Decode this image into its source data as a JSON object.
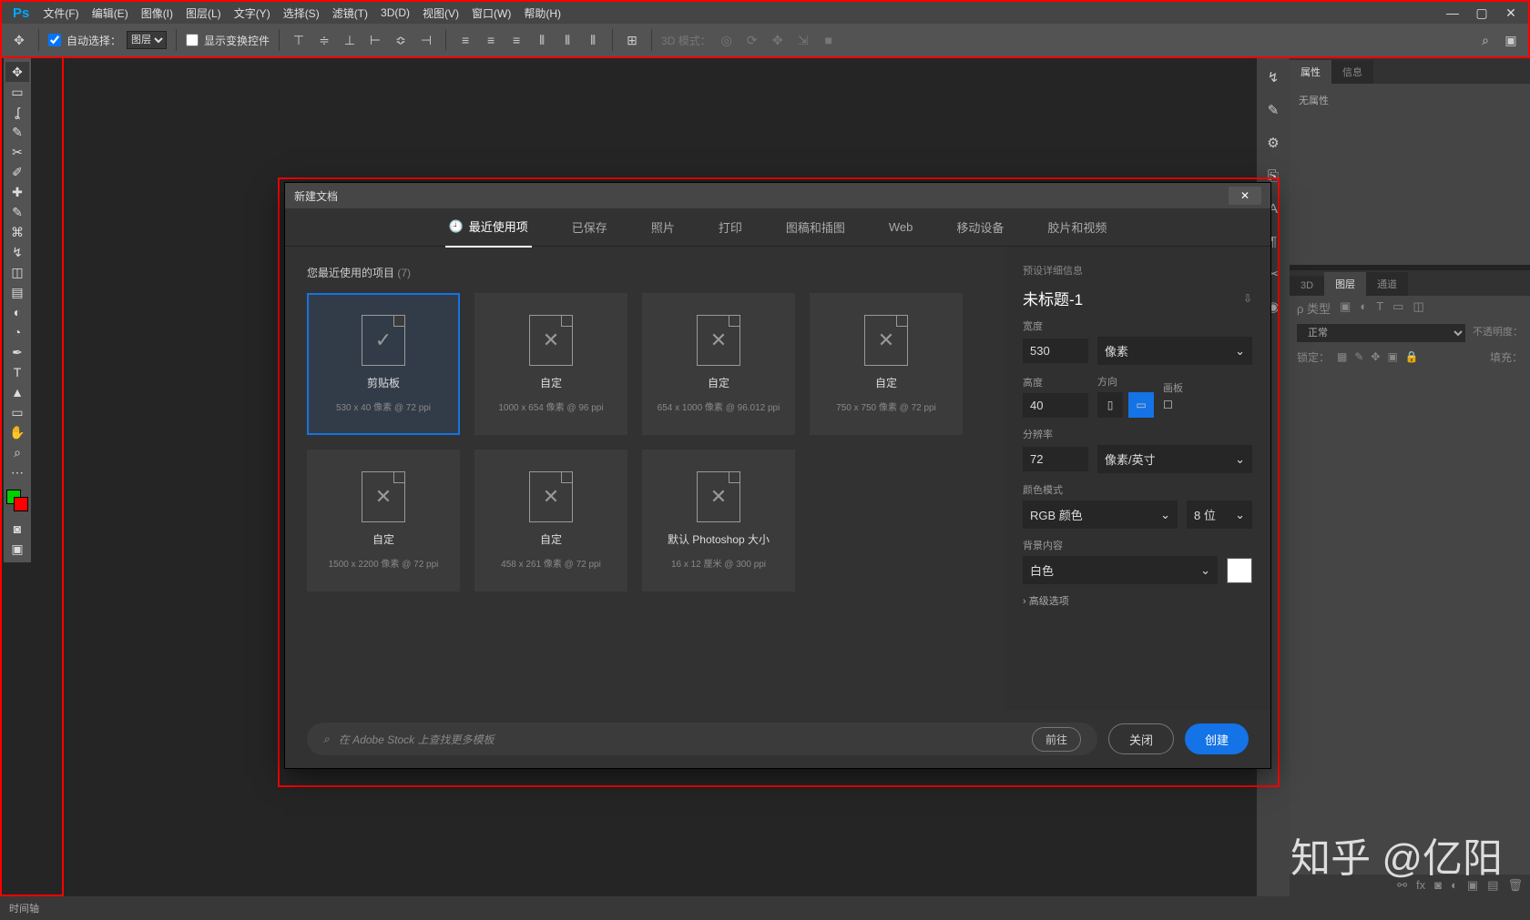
{
  "menubar": {
    "logo": "Ps",
    "items": [
      "文件(F)",
      "编辑(E)",
      "图像(I)",
      "图层(L)",
      "文字(Y)",
      "选择(S)",
      "滤镜(T)",
      "3D(D)",
      "视图(V)",
      "窗口(W)",
      "帮助(H)"
    ]
  },
  "optbar": {
    "auto_select": "自动选择：",
    "layer": "图层",
    "show_transform": "显示变换控件",
    "mode_3d": "3D 模式："
  },
  "dialog": {
    "title": "新建文档",
    "tabs": [
      "最近使用项",
      "已保存",
      "照片",
      "打印",
      "图稿和插图",
      "Web",
      "移动设备",
      "胶片和视频"
    ],
    "recent_label": "您最近使用的项目",
    "recent_count": "(7)",
    "presets": [
      {
        "name": "剪贴板",
        "dims": "530 x 40 像素 @ 72 ppi",
        "selected": true,
        "clip": true
      },
      {
        "name": "自定",
        "dims": "1000 x 654 像素 @ 96 ppi"
      },
      {
        "name": "自定",
        "dims": "654 x 1000 像素 @ 96.012 ppi"
      },
      {
        "name": "自定",
        "dims": "750 x 750 像素 @ 72 ppi"
      },
      {
        "name": "自定",
        "dims": "1500 x 2200 像素 @ 72 ppi"
      },
      {
        "name": "自定",
        "dims": "458 x 261 像素 @ 72 ppi"
      },
      {
        "name": "默认 Photoshop 大小",
        "dims": "16 x 12 厘米 @ 300 ppi"
      }
    ],
    "details": {
      "header": "预设详细信息",
      "name": "未标题-1",
      "width_label": "宽度",
      "width": "530",
      "width_unit": "像素",
      "height_label": "高度",
      "height": "40",
      "orient_label": "方向",
      "artboard_label": "画板",
      "res_label": "分辨率",
      "res": "72",
      "res_unit": "像素/英寸",
      "color_label": "颜色模式",
      "color_mode": "RGB 颜色",
      "color_depth": "8 位",
      "bg_label": "背景内容",
      "bg": "白色",
      "advanced": "高级选项"
    },
    "stock_placeholder": "在 Adobe Stock 上查找更多模板",
    "stock_go": "前往",
    "close": "关闭",
    "create": "创建"
  },
  "panels": {
    "prop_tabs": [
      "属性",
      "信息"
    ],
    "no_prop": "无属性",
    "layer_tabs": [
      "3D",
      "图层",
      "通道"
    ],
    "kind": "类型",
    "blend": "正常",
    "opacity_lbl": "不透明度：",
    "lock_lbl": "锁定：",
    "fill_lbl": "填充："
  },
  "status": {
    "timeline": "时间轴"
  },
  "watermark": "知乎 @亿阳"
}
